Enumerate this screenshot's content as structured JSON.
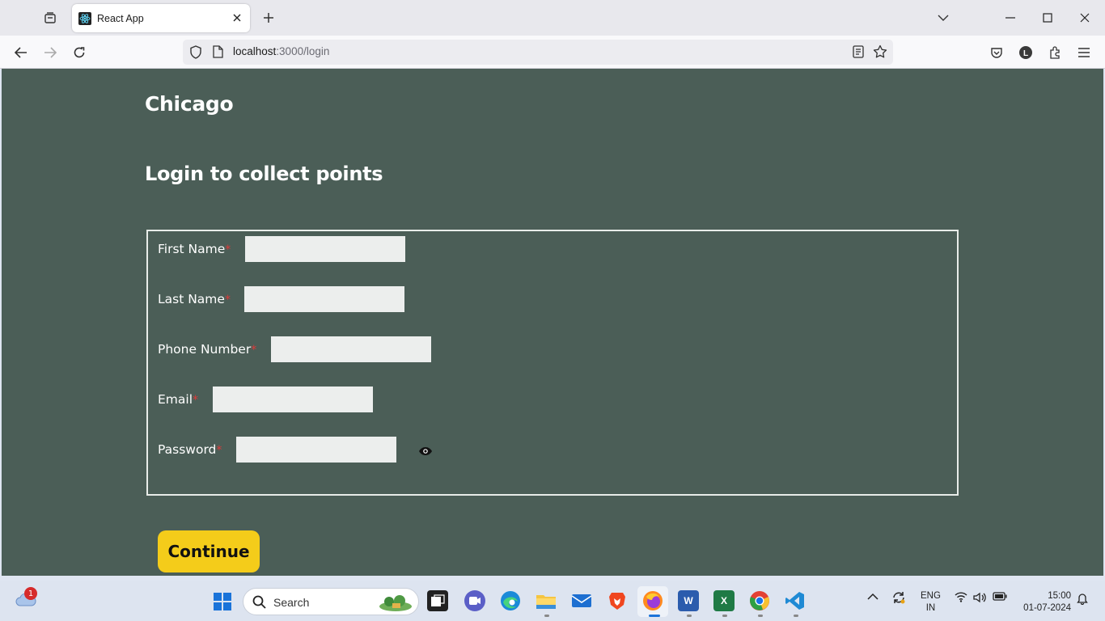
{
  "browser": {
    "tab": {
      "title": "React App"
    },
    "url": {
      "host": "localhost",
      "path": ":3000/login"
    }
  },
  "page": {
    "brand": "Chicago",
    "subtitle": "Login to collect points",
    "form": {
      "fields": [
        {
          "label": "First Name",
          "required": "*",
          "value": ""
        },
        {
          "label": "Last Name",
          "required": "*",
          "value": ""
        },
        {
          "label": "Phone Number",
          "required": "*",
          "value": ""
        },
        {
          "label": "Email",
          "required": "*",
          "value": ""
        },
        {
          "label": "Password",
          "required": "*",
          "value": ""
        }
      ]
    },
    "continue_label": "Continue"
  },
  "taskbar": {
    "notification_count": "1",
    "search_label": "Search",
    "lang_line1": "ENG",
    "lang_line2": "IN",
    "time": "15:00",
    "date": "01-07-2024"
  },
  "colors": {
    "page_background": "#4b5e57",
    "button_background": "#f4cc1a",
    "required_marker": "#e03a3a"
  }
}
